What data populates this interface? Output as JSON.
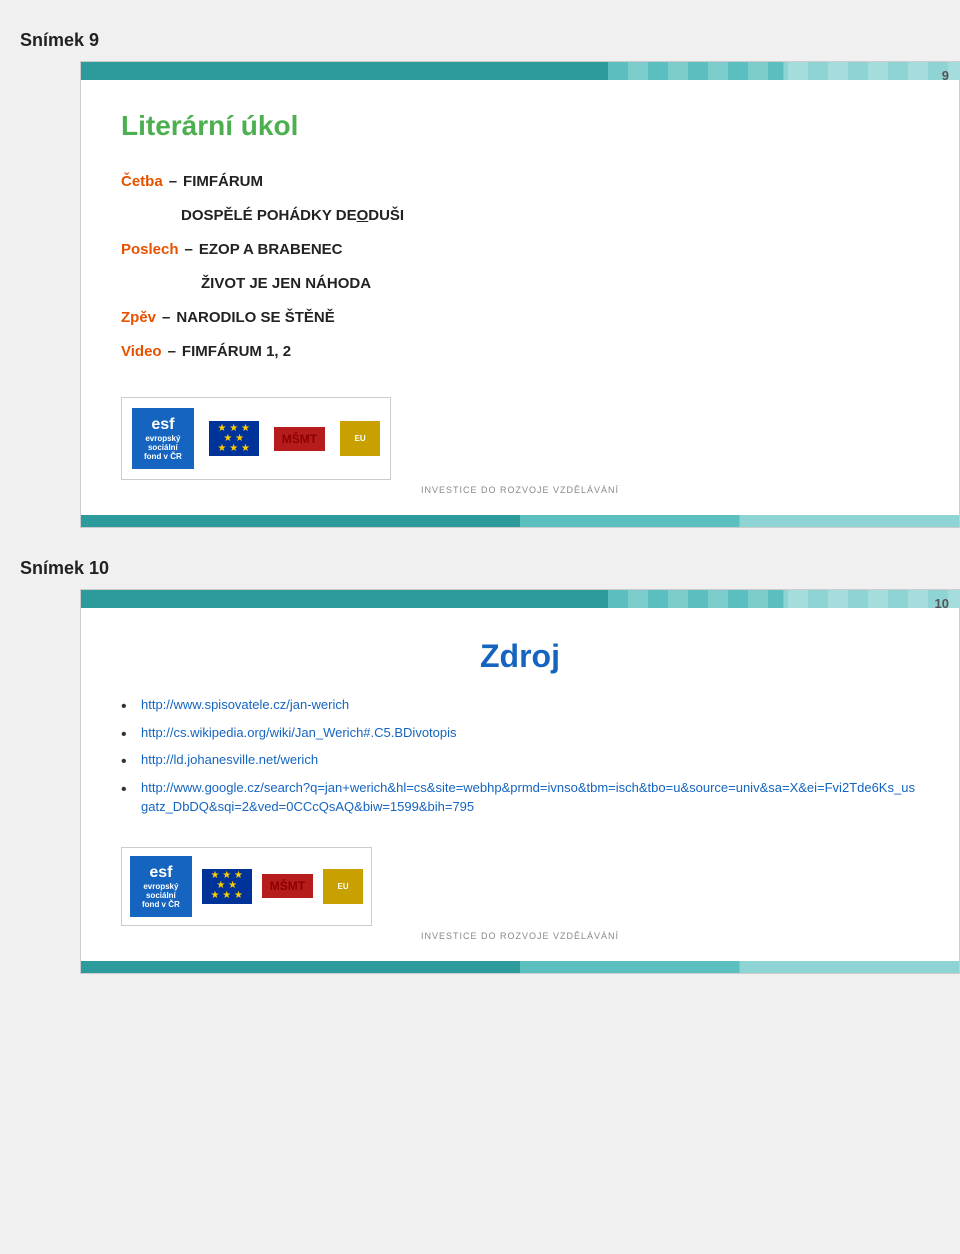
{
  "page": {
    "slides": [
      {
        "id": "slide9",
        "label": "Snímek 9",
        "number": "9",
        "title": "Literární úkol",
        "assignments": [
          {
            "label": "Četba",
            "text": "FIMFÁRUM DOSPĚLÉ POHÁDKY DE",
            "bold": "O",
            "text2": "DUŠI"
          },
          {
            "label": "Poslech",
            "text": "EZOP A BRABENEC ŽIVOT JE JEN NÁHODA"
          },
          {
            "label": "Zpěv",
            "text": "NARODILO SE ŠTĚNĚ"
          },
          {
            "label": "Video",
            "text": "FIMFÁRUM 1, 2"
          }
        ],
        "investice": "INVESTICE DO ROZVOJE VZDĚLÁVÁNÍ"
      },
      {
        "id": "slide10",
        "label": "Snímek 10",
        "number": "10",
        "title": "Zdroj",
        "sources": [
          "http://www.spisovatele.cz/jan-werich",
          "http://cs.wikipedia.org/wiki/Jan_Werich#.C5.BDivotopis",
          "http://ld.johanesville.net/werich",
          "http://www.google.cz/search?q=jan+werich&hl=cs&site=webhp&prmd=ivnso&tbm=isch&tbo=u&source=univ&sa=X&ei=Fvi2Tde6Ks_usgatz_DbDQ&sqi=2&ved=0CCcQsAQ&biw=1599&bih=795"
        ],
        "investice": "INVESTICE DO ROZVOJE VZDĚLÁVÁNÍ"
      }
    ]
  }
}
